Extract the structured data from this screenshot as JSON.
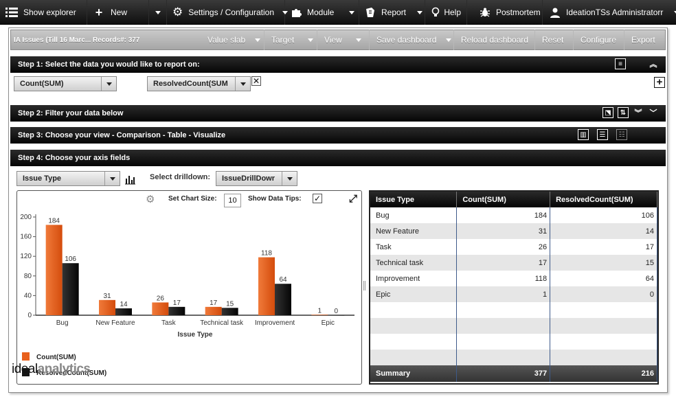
{
  "nav": {
    "show_explorer": "Show explorer",
    "new": "New",
    "settings": "Settings / Configuration",
    "module": "Module",
    "report": "Report",
    "help": "Help",
    "postmortem": "Postmortem",
    "user": "IdeationTSs Administratorr"
  },
  "dashboard": {
    "title": "IA Issues (Till 16 Marc...    Records#: 377",
    "buttons": [
      "Value slab",
      "Target",
      "View",
      "Save dashboard",
      "Reload dashboard",
      "Reset",
      "Configure",
      "Export"
    ]
  },
  "steps": {
    "step1": "Step 1: Select the data you would like to report on:",
    "step2": "Step 2: Filter your data below",
    "step3": "Step 3: Choose your view - Comparison - Table - Visualize",
    "step4": "Step 4: Choose your axis fields"
  },
  "measures": {
    "first": "Count(SUM)",
    "second": "ResolvedCount(SUM"
  },
  "axis": {
    "field": "Issue Type",
    "drilldown_label": "Select drilldown:",
    "drilldown_value": "IssueDrillDowr"
  },
  "chart_options": {
    "size_label": "Set Chart Size:",
    "size_value": "10",
    "tips_label": "Show Data Tips:"
  },
  "colors": {
    "count": "#e8601c",
    "resolved": "#151515"
  },
  "chart_data": {
    "type": "bar",
    "categories": [
      "Bug",
      "New Feature",
      "Task",
      "Technical task",
      "Improvement",
      "Epic"
    ],
    "series": [
      {
        "name": "Count(SUM)",
        "values": [
          184,
          31,
          26,
          17,
          118,
          1
        ]
      },
      {
        "name": "ResolvedCount(SUM)",
        "values": [
          106,
          14,
          17,
          15,
          64,
          0
        ]
      }
    ],
    "xlabel": "Issue Type",
    "ylabel": "",
    "ylim": [
      0,
      200
    ],
    "yticks": [
      0,
      40,
      80,
      120,
      160,
      200
    ],
    "legend": "bottom-left"
  },
  "table": {
    "headers": [
      "Issue Type",
      "Count(SUM)",
      "ResolvedCount(SUM)"
    ],
    "rows": [
      [
        "Bug",
        "184",
        "106"
      ],
      [
        "New Feature",
        "31",
        "14"
      ],
      [
        "Task",
        "26",
        "17"
      ],
      [
        "Technical task",
        "17",
        "15"
      ],
      [
        "Improvement",
        "118",
        "64"
      ],
      [
        "Epic",
        "1",
        "0"
      ]
    ],
    "summary": [
      "Summary",
      "377",
      "216"
    ]
  },
  "watermark": {
    "left": "ideal",
    "right": "analytics"
  }
}
